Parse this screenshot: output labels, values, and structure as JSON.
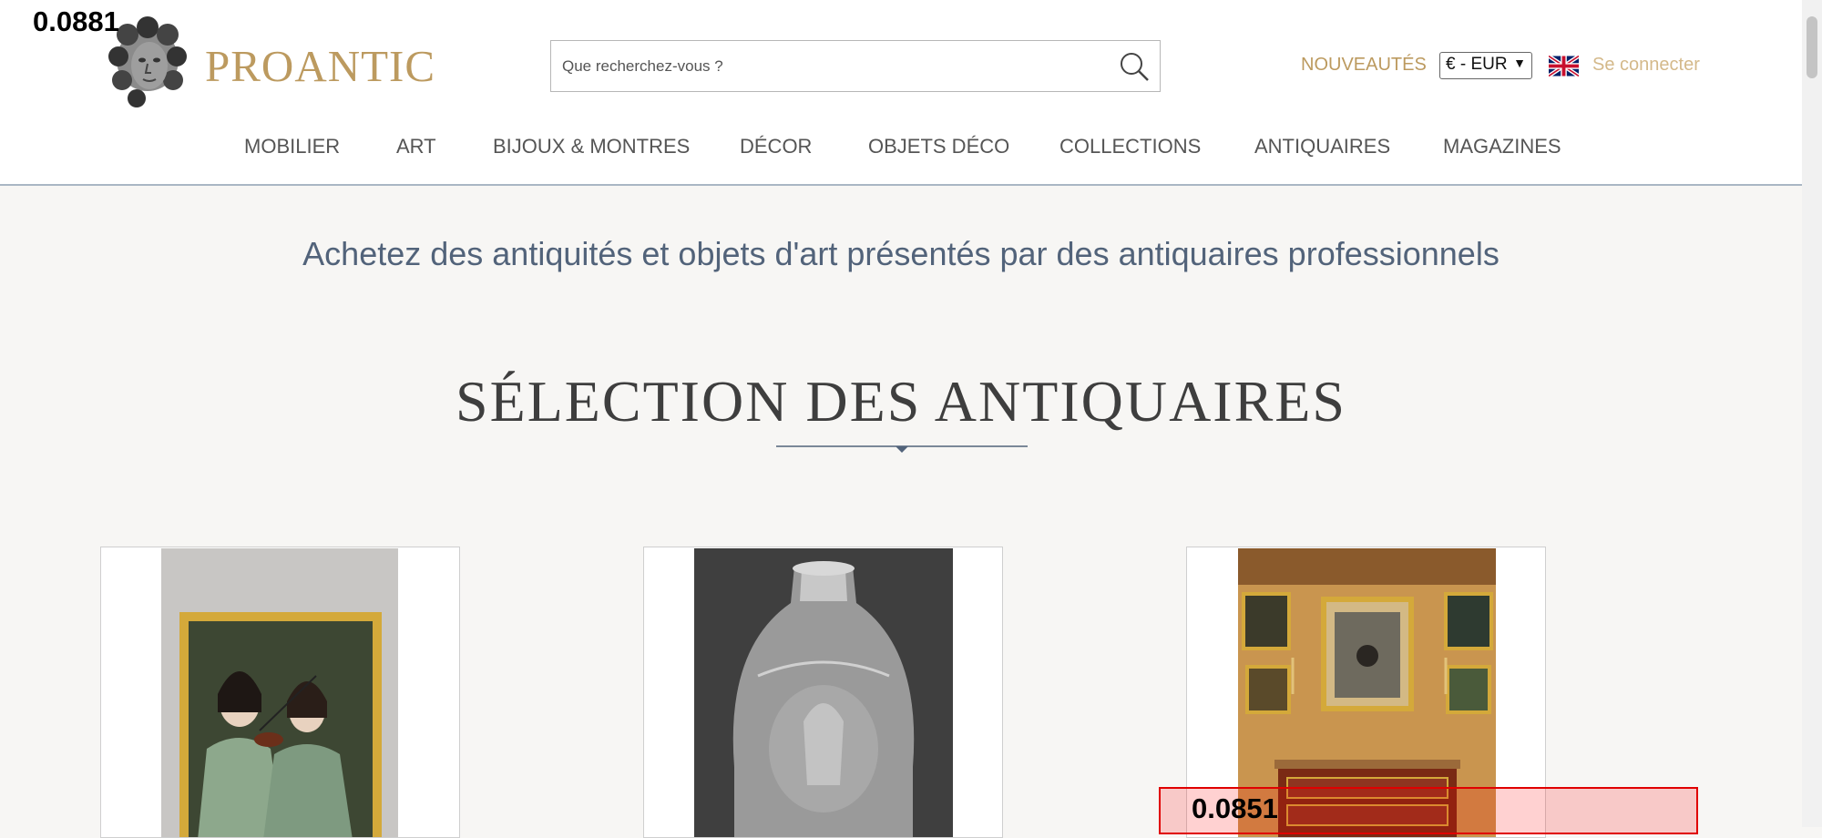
{
  "overlay": {
    "score_top": "0.0881",
    "score_bottom": "0.0851"
  },
  "header": {
    "logo_text": "PROANTIC",
    "search_placeholder": "Que recherchez-vous ?",
    "nouveautes": "NOUVEAUTÉS",
    "currency": "€ - EUR",
    "login": "Se connecter"
  },
  "nav": {
    "items": [
      "MOBILIER",
      "ART",
      "BIJOUX & MONTRES",
      "DÉCOR",
      "OBJETS DÉCO",
      "COLLECTIONS",
      "ANTIQUAIRES",
      "MAGAZINES"
    ]
  },
  "main": {
    "tagline": "Achetez des antiquités et objets d'art présentés par des antiquaires professionnels",
    "section_title": "SÉLECTION DES ANTIQUAIRES"
  },
  "colors": {
    "gold": "#bc9a5f",
    "slate": "#52637a",
    "overlay_red": "#e00000"
  }
}
